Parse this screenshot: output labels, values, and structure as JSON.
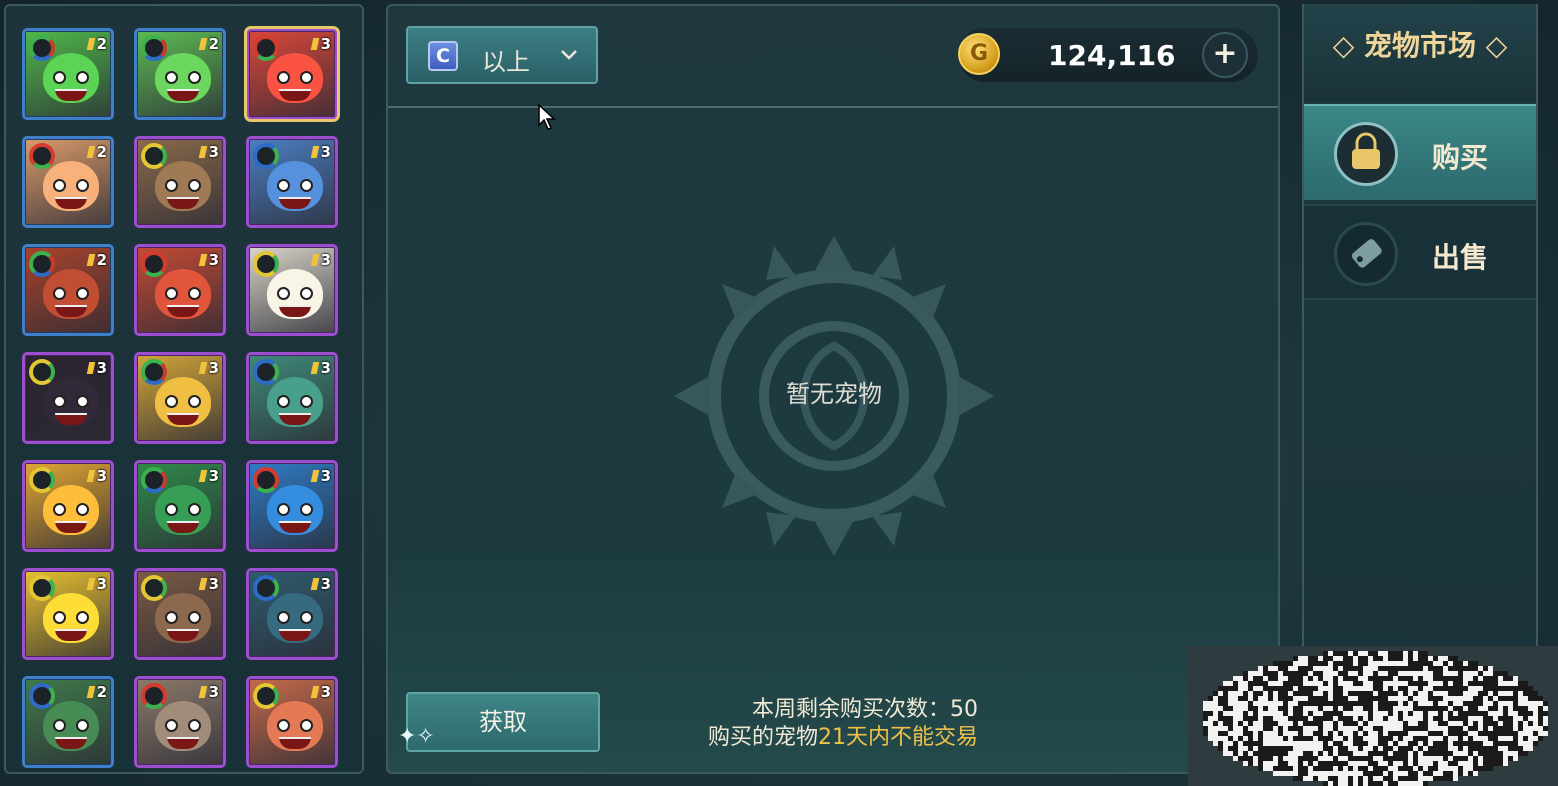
{
  "filter": {
    "grade": "C",
    "label": "以上"
  },
  "currency": {
    "icon": "gold-coin-icon",
    "amount": "124,116"
  },
  "center": {
    "empty_text": "暂无宠物",
    "get_button": "获取",
    "remaining_label": "本周剩余购买次数：50",
    "trade_prefix": "购买的宠物",
    "trade_highlight": "21天内不能交易"
  },
  "market": {
    "title": "◇ 宠物市场 ◇"
  },
  "tabs": {
    "buy": "购买",
    "sell": "出售"
  },
  "pets": [
    {
      "stars": "2",
      "rarity": "r2",
      "ring": "grn",
      "color": "#4fb84a",
      "selected": false
    },
    {
      "stars": "2",
      "rarity": "r2",
      "ring": "grn",
      "color": "#5dbb53",
      "selected": false
    },
    {
      "stars": "3",
      "rarity": "r3",
      "ring": "red",
      "color": "#d9473a",
      "selected": true
    },
    {
      "stars": "2",
      "rarity": "r2",
      "ring": "red",
      "color": "#d89a6a",
      "selected": false
    },
    {
      "stars": "3",
      "rarity": "r3",
      "ring": "yel",
      "color": "#8a6a4a",
      "selected": false
    },
    {
      "stars": "3",
      "rarity": "r3",
      "ring": "blu",
      "color": "#4b7ec0",
      "selected": false
    },
    {
      "stars": "2",
      "rarity": "r2",
      "ring": "grn",
      "color": "#a8432c",
      "selected": false
    },
    {
      "stars": "3",
      "rarity": "r3",
      "ring": "red",
      "color": "#c44a35",
      "selected": false
    },
    {
      "stars": "3",
      "rarity": "r3",
      "ring": "yel",
      "color": "#d8d4c8",
      "selected": false
    },
    {
      "stars": "3",
      "rarity": "r3",
      "ring": "yel",
      "color": "#2b2430",
      "selected": false
    },
    {
      "stars": "3",
      "rarity": "r3",
      "ring": "grn",
      "color": "#d1a53a",
      "selected": false
    },
    {
      "stars": "3",
      "rarity": "r3",
      "ring": "blu",
      "color": "#3f8a7a",
      "selected": false
    },
    {
      "stars": "3",
      "rarity": "r3",
      "ring": "yel",
      "color": "#e0a532",
      "selected": false
    },
    {
      "stars": "3",
      "rarity": "r3",
      "ring": "grn",
      "color": "#2f8a4a",
      "selected": false
    },
    {
      "stars": "3",
      "rarity": "r3",
      "ring": "red",
      "color": "#2e7bc3",
      "selected": false
    },
    {
      "stars": "3",
      "rarity": "r3",
      "ring": "yel",
      "color": "#e6c030",
      "selected": false
    },
    {
      "stars": "3",
      "rarity": "r3",
      "ring": "yel",
      "color": "#7a5a44",
      "selected": false
    },
    {
      "stars": "3",
      "rarity": "r3",
      "ring": "blu",
      "color": "#2e5c6e",
      "selected": false
    },
    {
      "stars": "2",
      "rarity": "r2",
      "ring": "blu",
      "color": "#3f7a4a",
      "selected": false
    },
    {
      "stars": "3",
      "rarity": "r3",
      "ring": "red",
      "color": "#8c7a6a",
      "selected": false
    },
    {
      "stars": "3",
      "rarity": "r3",
      "ring": "yel",
      "color": "#c56a4a",
      "selected": false
    }
  ]
}
